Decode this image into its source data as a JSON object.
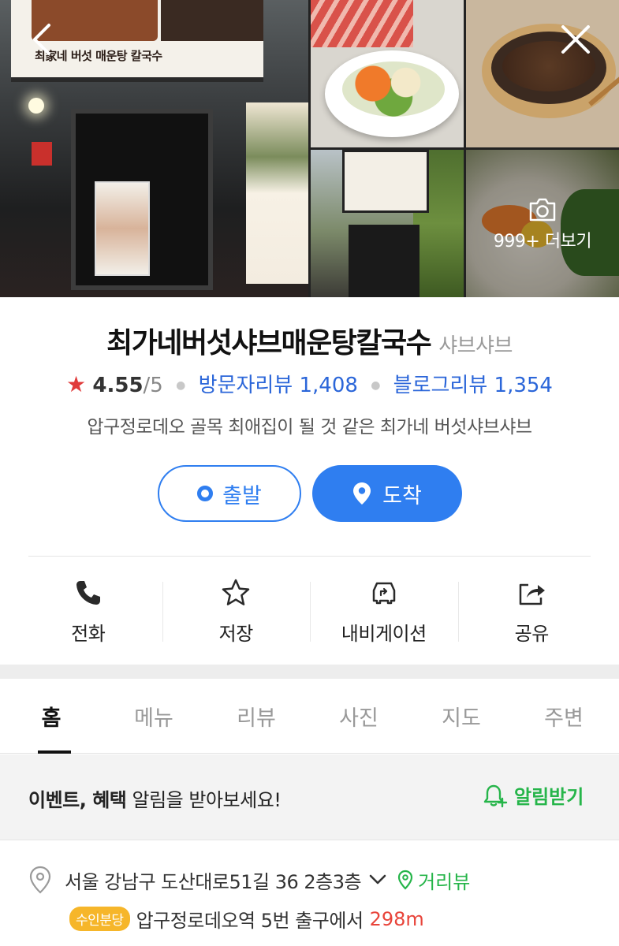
{
  "nav": {
    "back_icon": "chevron-left-icon",
    "close_icon": "close-icon"
  },
  "photos": {
    "sign_text": "최家네 버섯 매운탕 칼국수",
    "more_label": "999+ 더보기",
    "more_icon": "camera-icon"
  },
  "place": {
    "name": "최가네버섯샤브매운탕칼국수",
    "category": "샤브샤브",
    "rating": "4.55",
    "rating_max": "/5",
    "visitor_review_label": "방문자리뷰 1,408",
    "blog_review_label": "블로그리뷰 1,354",
    "description": "압구정로데오 골목 최애집이 될 것 같은 최가네 버섯샤브샤브"
  },
  "route": {
    "depart_label": "출발",
    "arrive_label": "도착"
  },
  "actions": [
    {
      "label": "전화",
      "icon": "phone-icon"
    },
    {
      "label": "저장",
      "icon": "star-icon"
    },
    {
      "label": "내비게이션",
      "icon": "navigation-icon"
    },
    {
      "label": "공유",
      "icon": "share-icon"
    }
  ],
  "tabs": [
    {
      "label": "홈",
      "active": true
    },
    {
      "label": "메뉴"
    },
    {
      "label": "리뷰"
    },
    {
      "label": "사진"
    },
    {
      "label": "지도"
    },
    {
      "label": "주변"
    }
  ],
  "notice": {
    "bold1": "이벤트, 혜택",
    "rest": " 알림을 받아보세요!",
    "alarm_label": "알림받기"
  },
  "address": {
    "text": "서울 강남구 도산대로51길 36 2층3층",
    "streetview_label": "거리뷰"
  },
  "station": {
    "line_badge": "수인분당",
    "station_text": "압구정로데오역 5번 출구에서",
    "distance": "298m"
  },
  "colors": {
    "accent_blue": "#2f7ef0",
    "link_blue": "#2b66d9",
    "green": "#26b54a",
    "star_red": "#e03a3a",
    "distance_red": "#e8443a",
    "badge_yellow": "#f6b62a"
  }
}
